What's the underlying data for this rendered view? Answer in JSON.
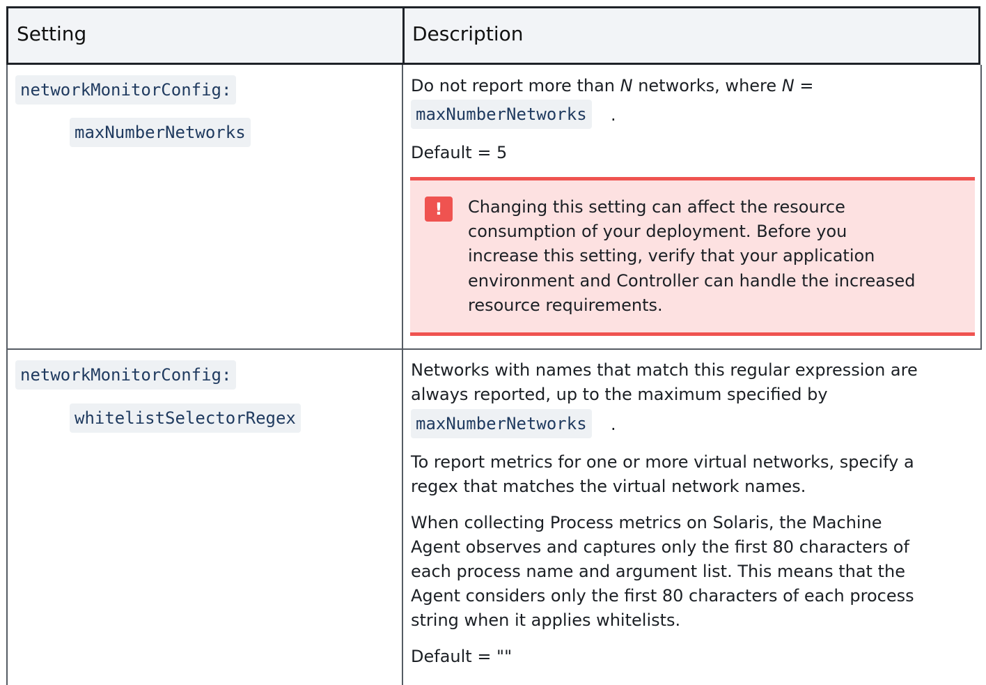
{
  "header": {
    "col1": "Setting",
    "col2": "Description"
  },
  "row1": {
    "setting_parent": "networkMonitorConfig:",
    "setting_child": "maxNumberNetworks",
    "desc_line1_a": "Do not report more than ",
    "desc_line1_n1": "N",
    "desc_line1_b": " networks, where ",
    "desc_line1_n2": "N",
    "desc_line1_c": " =",
    "desc_code": "maxNumberNetworks",
    "desc_period": ".",
    "default": "Default = 5",
    "callout_icon": "!",
    "callout_lines": [
      "Changing this setting can affect the resource",
      "consumption of your deployment. Before you",
      "increase this setting, verify that your application",
      "environment and Controller can handle the increased",
      "resource requirements."
    ]
  },
  "row2": {
    "setting_parent": "networkMonitorConfig:",
    "setting_child": "whitelistSelectorRegex",
    "p1_lines": [
      "Networks with names that match this regular expression are",
      "always reported, up to the maximum specified by"
    ],
    "p1_code": "maxNumberNetworks",
    "p1_period": ".",
    "p2_lines": [
      "To report metrics for one or more virtual networks, specify a",
      "regex that matches the virtual network names."
    ],
    "p3_lines": [
      "When collecting Process metrics on Solaris, the Machine",
      "Agent observes and captures only the first 80 characters of",
      "each process name and argument list. This means that the",
      "Agent considers only the first 80 characters of each process",
      "string when it applies whitelists."
    ],
    "default": "Default = \"\""
  },
  "icons": {
    "warning": "exclamation-icon"
  },
  "colors": {
    "callout_bg": "#fde1e1",
    "callout_border": "#ef5350",
    "header_bg": "#f2f4f7"
  }
}
